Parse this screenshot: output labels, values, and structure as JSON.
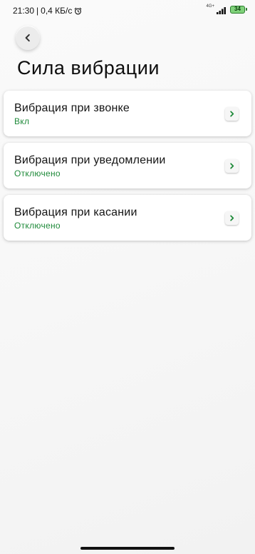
{
  "status_bar": {
    "time": "21:30",
    "separator": "|",
    "net_speed": "0,4 КБ/с",
    "network_type": "4G+",
    "battery_level": "34"
  },
  "page": {
    "title": "Сила вибрации"
  },
  "settings": [
    {
      "title": "Вибрация при звонке",
      "value": "Вкл"
    },
    {
      "title": "Вибрация при уведомлении",
      "value": "Отключено"
    },
    {
      "title": "Вибрация при касании",
      "value": "Отключено"
    }
  ],
  "icons": {
    "back": "chevron-left-icon",
    "item_arrow": "chevron-right-icon",
    "alarm": "alarm-clock-icon",
    "signal": "signal-bars-icon",
    "battery": "battery-icon"
  },
  "colors": {
    "accent_green": "#1f8a3a",
    "battery_fill": "#7fd27a"
  }
}
